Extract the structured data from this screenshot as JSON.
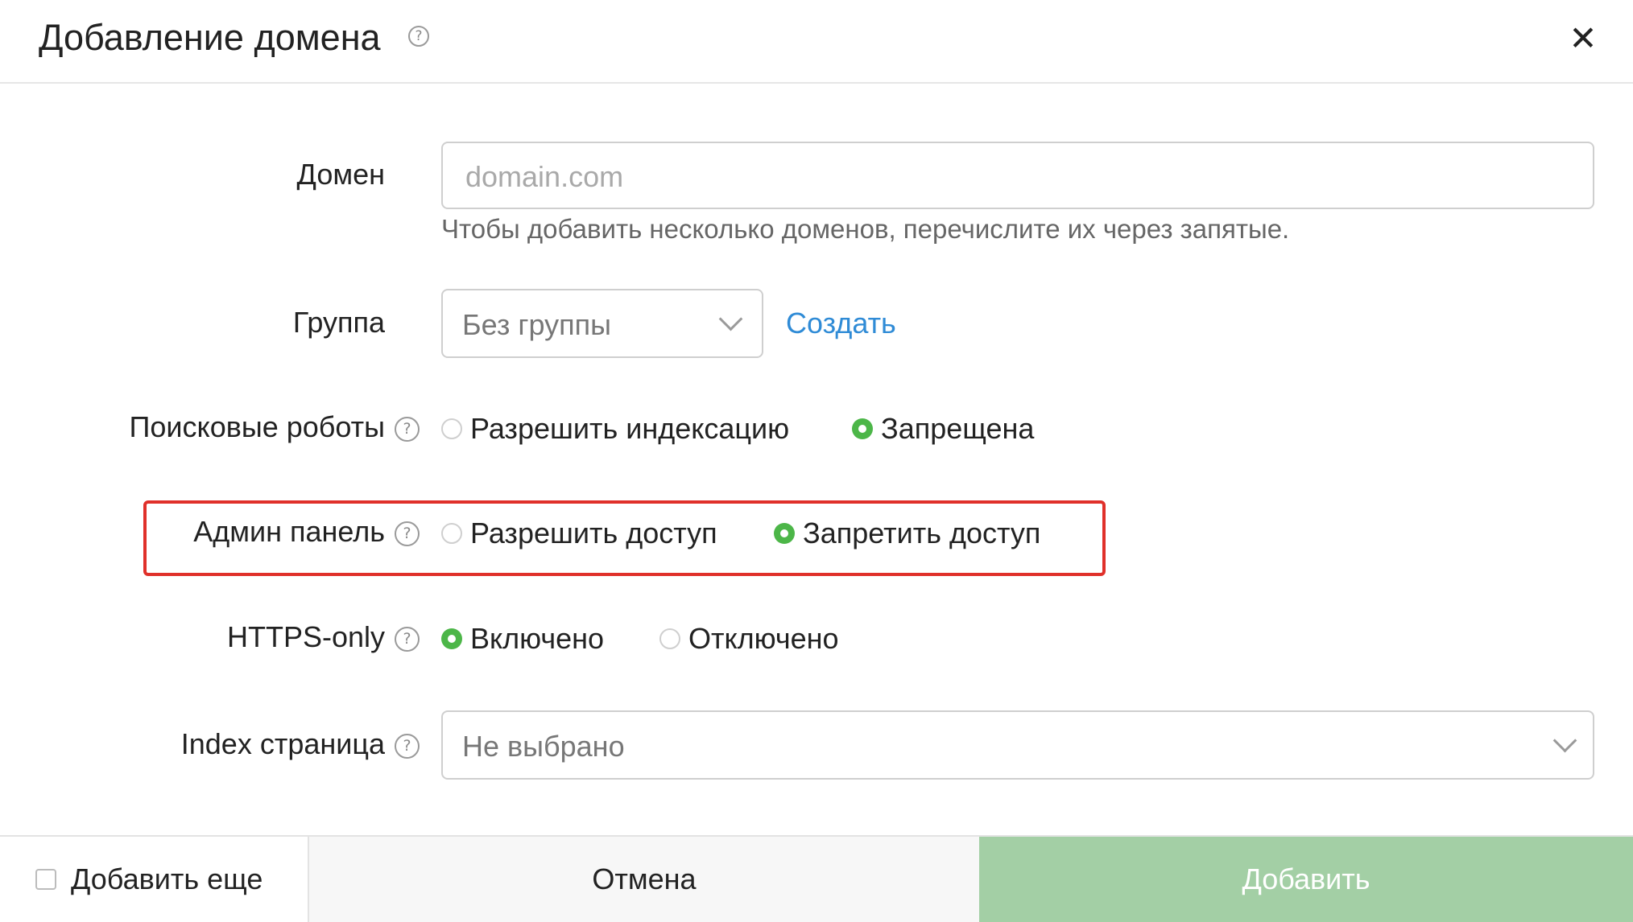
{
  "dialog": {
    "title": "Добавление домена",
    "help_icon": "question-circle-icon",
    "close_icon": "close-icon",
    "close_glyph": "✕"
  },
  "form": {
    "domain": {
      "label": "Домен",
      "placeholder": "domain.com",
      "value": "",
      "hint": "Чтобы добавить несколько доменов, перечислите их через запятые."
    },
    "group": {
      "label": "Группа",
      "selected": "Без группы",
      "create_link": "Создать"
    },
    "robots": {
      "label": "Поисковые роботы",
      "options": [
        {
          "label": "Разрешить индексацию",
          "selected": false
        },
        {
          "label": "Запрещена",
          "selected": true
        }
      ]
    },
    "admin_panel": {
      "label": "Админ панель",
      "options": [
        {
          "label": "Разрешить доступ",
          "selected": false
        },
        {
          "label": "Запретить доступ",
          "selected": true
        }
      ]
    },
    "https_only": {
      "label": "HTTPS-only",
      "options": [
        {
          "label": "Включено",
          "selected": true
        },
        {
          "label": "Отключено",
          "selected": false
        }
      ]
    },
    "index_page": {
      "label": "Index страница",
      "selected": "Не выбрано"
    }
  },
  "footer": {
    "add_more_label": "Добавить еще",
    "add_more_checked": false,
    "cancel_label": "Отмена",
    "submit_label": "Добавить"
  },
  "colors": {
    "accent_green": "#4cb648",
    "submit_green": "#a3cfa5",
    "link_blue": "#2f8bd6",
    "highlight_red": "#e0302a"
  }
}
